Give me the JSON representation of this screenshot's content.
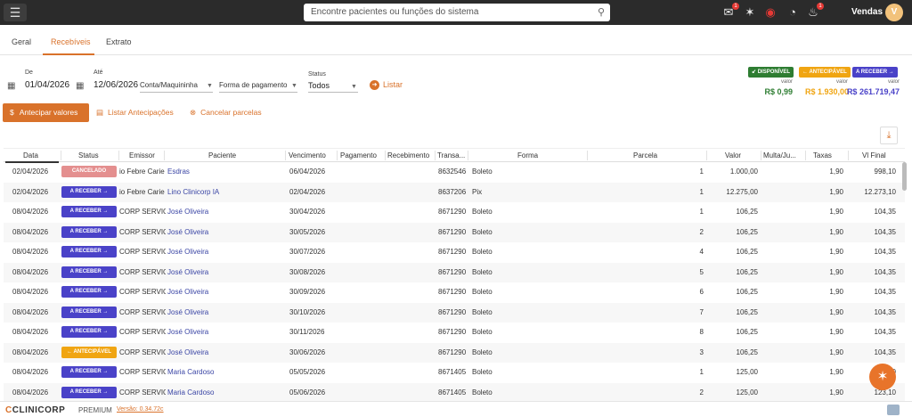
{
  "topbar": {
    "search_placeholder": "Encontre pacientes ou funções do sistema",
    "user_label": "Vendas",
    "avatar_initial": "V",
    "notification_count": "1",
    "chat_count": "1"
  },
  "tabs": [
    {
      "label": "Geral"
    },
    {
      "label": "Recebíveis"
    },
    {
      "label": "Extrato"
    }
  ],
  "filters": {
    "de_label": "De",
    "de_value": "01/04/2026",
    "ate_label": "Até",
    "ate_value": "12/06/2026",
    "conta_value": "Conta/Maquininha",
    "forma_value": "Forma de pagamento",
    "status_label": "Status",
    "status_value": "Todos",
    "listar_label": "Listar"
  },
  "summary": [
    {
      "badge": "DISPONÍVEL",
      "label": "valor",
      "amount": "R$ 0,99",
      "color": "#2e7d32"
    },
    {
      "badge": "ANTECIPÁVEL",
      "label": "valor",
      "amount": "R$ 1.930,00",
      "color": "#f0a512"
    },
    {
      "badge": "A RECEBER",
      "label": "valor",
      "amount": "R$ 261.719,47",
      "color": "#4a42c8"
    }
  ],
  "actions": {
    "anticipar": "Antecipar valores",
    "listar_antecipacoes": "Listar Antecipações",
    "cancelar_parcelas": "Cancelar parcelas"
  },
  "columns": [
    "Data",
    "Status",
    "Emissor",
    "Paciente",
    "Vencimento",
    "Pagamento",
    "Recebimento",
    "Transa...",
    "Forma",
    "Parcela",
    "Valor",
    "Multa/Ju...",
    "Taxas",
    "Vl Final"
  ],
  "rows": [
    {
      "data": "02/04/2026",
      "status": "CANCELADO",
      "status_type": "cancelado",
      "emissor": "io Febre Carie",
      "paciente": "Esdras",
      "vencimento": "06/04/2026",
      "transacao": "8632546",
      "forma": "Boleto",
      "parcela": "1",
      "valor": "1.000,00",
      "taxas": "1,90",
      "final": "998,10"
    },
    {
      "data": "02/04/2026",
      "status": "A RECEBER",
      "status_type": "receber",
      "emissor": "io Febre Carie",
      "paciente": "Lino Clinicorp IA",
      "vencimento": "02/04/2026",
      "transacao": "8637206",
      "forma": "Pix",
      "parcela": "1",
      "valor": "12.275,00",
      "taxas": "1,90",
      "final": "12.273,10"
    },
    {
      "data": "08/04/2026",
      "status": "A RECEBER",
      "status_type": "receber",
      "emissor": "CORP SERVICO",
      "paciente": "José Oliveira",
      "vencimento": "30/04/2026",
      "transacao": "8671290",
      "forma": "Boleto",
      "parcela": "1",
      "valor": "106,25",
      "taxas": "1,90",
      "final": "104,35"
    },
    {
      "data": "08/04/2026",
      "status": "A RECEBER",
      "status_type": "receber",
      "emissor": "CORP SERVICO",
      "paciente": "José Oliveira",
      "vencimento": "30/05/2026",
      "transacao": "8671290",
      "forma": "Boleto",
      "parcela": "2",
      "valor": "106,25",
      "taxas": "1,90",
      "final": "104,35"
    },
    {
      "data": "08/04/2026",
      "status": "A RECEBER",
      "status_type": "receber",
      "emissor": "CORP SERVICO",
      "paciente": "José Oliveira",
      "vencimento": "30/07/2026",
      "transacao": "8671290",
      "forma": "Boleto",
      "parcela": "4",
      "valor": "106,25",
      "taxas": "1,90",
      "final": "104,35"
    },
    {
      "data": "08/04/2026",
      "status": "A RECEBER",
      "status_type": "receber",
      "emissor": "CORP SERVICO",
      "paciente": "José Oliveira",
      "vencimento": "30/08/2026",
      "transacao": "8671290",
      "forma": "Boleto",
      "parcela": "5",
      "valor": "106,25",
      "taxas": "1,90",
      "final": "104,35"
    },
    {
      "data": "08/04/2026",
      "status": "A RECEBER",
      "status_type": "receber",
      "emissor": "CORP SERVICO",
      "paciente": "José Oliveira",
      "vencimento": "30/09/2026",
      "transacao": "8671290",
      "forma": "Boleto",
      "parcela": "6",
      "valor": "106,25",
      "taxas": "1,90",
      "final": "104,35"
    },
    {
      "data": "08/04/2026",
      "status": "A RECEBER",
      "status_type": "receber",
      "emissor": "CORP SERVICO",
      "paciente": "José Oliveira",
      "vencimento": "30/10/2026",
      "transacao": "8671290",
      "forma": "Boleto",
      "parcela": "7",
      "valor": "106,25",
      "taxas": "1,90",
      "final": "104,35"
    },
    {
      "data": "08/04/2026",
      "status": "A RECEBER",
      "status_type": "receber",
      "emissor": "CORP SERVICO",
      "paciente": "José Oliveira",
      "vencimento": "30/11/2026",
      "transacao": "8671290",
      "forma": "Boleto",
      "parcela": "8",
      "valor": "106,25",
      "taxas": "1,90",
      "final": "104,35"
    },
    {
      "data": "08/04/2026",
      "status": "ANTECIPÁVEL",
      "status_type": "antecipavel",
      "emissor": "CORP SERVICO",
      "paciente": "José Oliveira",
      "vencimento": "30/06/2026",
      "transacao": "8671290",
      "forma": "Boleto",
      "parcela": "3",
      "valor": "106,25",
      "taxas": "1,90",
      "final": "104,35"
    },
    {
      "data": "08/04/2026",
      "status": "A RECEBER",
      "status_type": "receber",
      "emissor": "CORP SERVICO",
      "paciente": "Maria Cardoso",
      "vencimento": "05/05/2026",
      "transacao": "8671405",
      "forma": "Boleto",
      "parcela": "1",
      "valor": "125,00",
      "taxas": "1,90",
      "final": "123,10"
    },
    {
      "data": "08/04/2026",
      "status": "A RECEBER",
      "status_type": "receber",
      "emissor": "CORP SERVICO",
      "paciente": "Maria Cardoso",
      "vencimento": "05/06/2026",
      "transacao": "8671405",
      "forma": "Boleto",
      "parcela": "2",
      "valor": "125,00",
      "taxas": "1,90",
      "final": "123,10"
    }
  ],
  "footer": {
    "brand_mark": "C",
    "brand_text": "CLINICORP",
    "plan": "PREMIUM",
    "version": "Versão: 0.34.72c"
  },
  "icons": [
    "menu-icon",
    "search-icon",
    "chat-icon",
    "sparkle-icon",
    "record-icon",
    "speedometer-icon",
    "bell-icon",
    "calendar-icon",
    "chevron-down-icon",
    "download-icon",
    "arrow-right-icon",
    "arrow-left-icon",
    "dollar-icon",
    "list-icon",
    "cancel-icon",
    "sparkle-fab-icon"
  ]
}
